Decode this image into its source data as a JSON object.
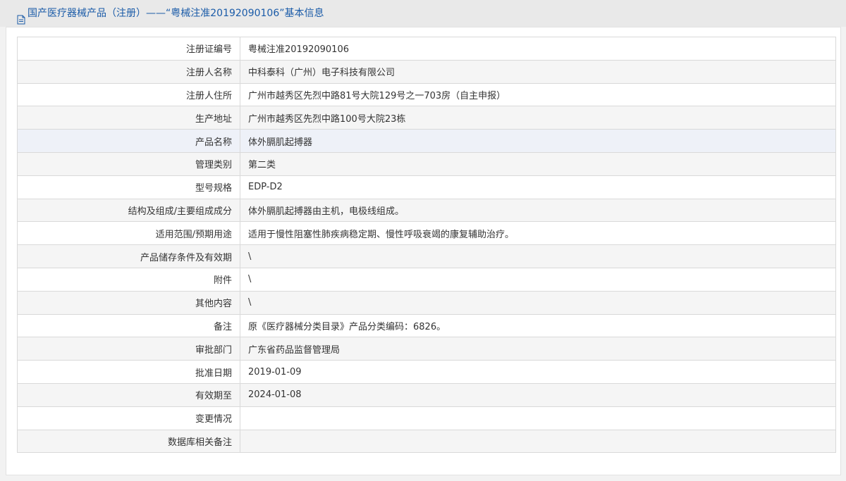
{
  "header": {
    "title": "国产医疗器械产品（注册）——“粤械注准20192090106”基本信息"
  },
  "rows": [
    {
      "label": "注册证编号",
      "value": "粤械注准20192090106"
    },
    {
      "label": "注册人名称",
      "value": "中科泰科（广州）电子科技有限公司"
    },
    {
      "label": "注册人住所",
      "value": "广州市越秀区先烈中路81号大院129号之一703房（自主申报）"
    },
    {
      "label": "生产地址",
      "value": "广州市越秀区先烈中路100号大院23栋"
    },
    {
      "label": "产品名称",
      "value": "体外膈肌起搏器"
    },
    {
      "label": "管理类别",
      "value": "第二类"
    },
    {
      "label": "型号规格",
      "value": "EDP-D2"
    },
    {
      "label": "结构及组成/主要组成成分",
      "value": "体外膈肌起搏器由主机，电极线组成。"
    },
    {
      "label": "适用范围/预期用途",
      "value": "适用于慢性阻塞性肺疾病稳定期、慢性呼吸衰竭的康复辅助治疗。"
    },
    {
      "label": "产品储存条件及有效期",
      "value": "\\"
    },
    {
      "label": "附件",
      "value": "\\"
    },
    {
      "label": "其他内容",
      "value": "\\"
    },
    {
      "label": "备注",
      "value": "原《医疗器械分类目录》产品分类编码：6826。"
    },
    {
      "label": "审批部门",
      "value": "广东省药品监督管理局"
    },
    {
      "label": "批准日期",
      "value": "2019-01-09"
    },
    {
      "label": "有效期至",
      "value": "2024-01-08"
    },
    {
      "label": "变更情况",
      "value": ""
    },
    {
      "label": "数据库相关备注",
      "value": ""
    }
  ]
}
